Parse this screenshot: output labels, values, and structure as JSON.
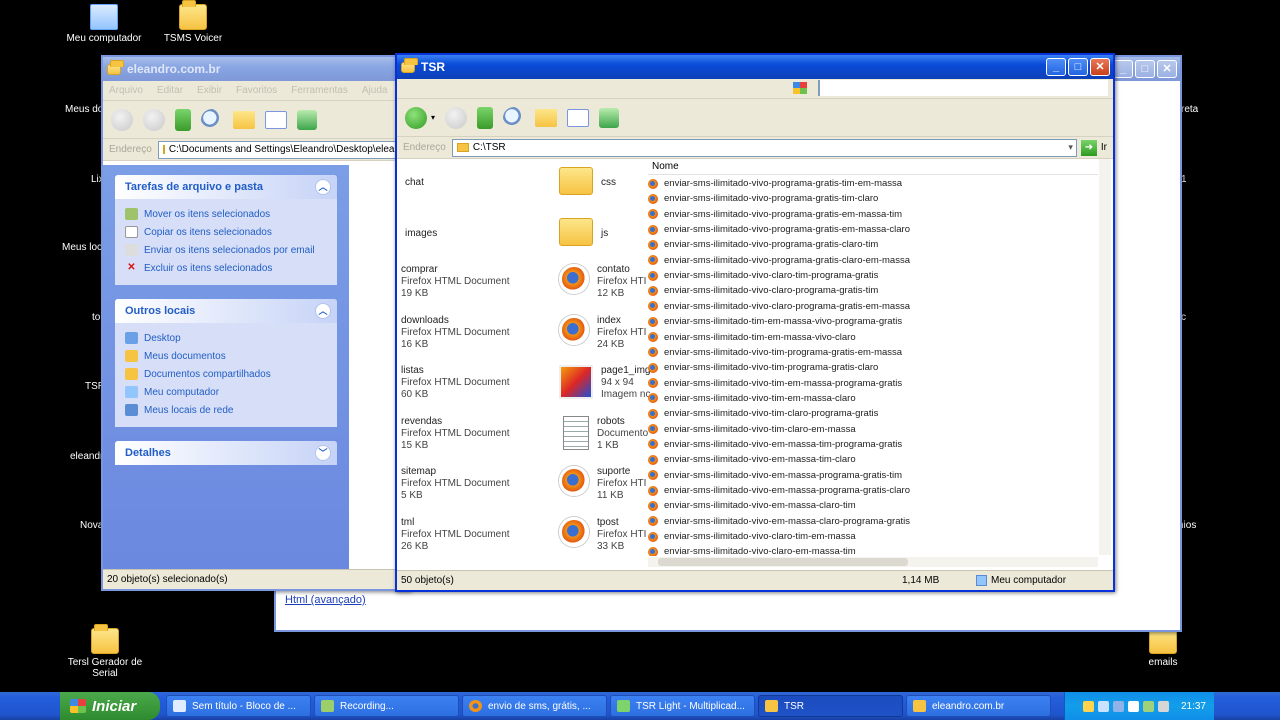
{
  "desktop": {
    "icons_left": [
      {
        "name": "Meu computador"
      },
      {
        "name": "Meus do"
      },
      {
        "name": "Lix"
      },
      {
        "name": "Meus loca"
      },
      {
        "name": "to"
      },
      {
        "name": "TSR"
      },
      {
        "name": "eleandr"
      },
      {
        "name": "Nova"
      },
      {
        "name": "Tersl Gerador de Serial"
      }
    ],
    "icon_tsms": "TSMS Voicer",
    "icon_emails": "emails",
    "right_edge_labels": [
      "reta",
      "1",
      "c",
      "nios"
    ]
  },
  "back_window": {
    "title": "",
    "link": "Html (avançado)"
  },
  "eleandro_window": {
    "title": "eleandro.com.br",
    "menu": [
      "Arquivo",
      "Editar",
      "Exibir",
      "Favoritos",
      "Ferramentas",
      "Ajuda"
    ],
    "address_label": "Endereço",
    "address": "C:\\Documents and Settings\\Eleandro\\Desktop\\eleandro.com.br",
    "panels": {
      "tasks_title": "Tarefas de arquivo e pasta",
      "tasks": [
        "Mover os itens selecionados",
        "Copiar os itens selecionados",
        "Enviar os itens selecionados por email",
        "Excluir os itens selecionados"
      ],
      "places_title": "Outros locais",
      "places": [
        "Desktop",
        "Meus documentos",
        "Documentos compartilhados",
        "Meu computador",
        "Meus locais de rede"
      ],
      "details_title": "Detalhes"
    },
    "items_col1": [
      {
        "name": "chat",
        "type": "",
        "size": ""
      },
      {
        "name": "images",
        "type": "",
        "size": ""
      },
      {
        "name": "comprar",
        "type": "Firefox HTML Document",
        "size": "19 KB"
      },
      {
        "name": "downloads",
        "type": "Firefox HTML Document",
        "size": "16 KB"
      },
      {
        "name": "listas",
        "type": "Firefox HTML Document",
        "size": "60 KB"
      },
      {
        "name": "revendas",
        "type": "Firefox HTML Document",
        "size": "15 KB"
      },
      {
        "name": "sitemap",
        "type": "Firefox HTML Document",
        "size": "5 KB"
      },
      {
        "name": "tml",
        "type": "Firefox HTML Document",
        "size": "26 KB"
      }
    ],
    "items_col2": [
      {
        "name": "css",
        "type": "",
        "size": ""
      },
      {
        "name": "js",
        "type": "",
        "size": ""
      },
      {
        "name": "contato",
        "type": "Firefox HTI",
        "size": "12 KB"
      },
      {
        "name": "index",
        "type": "Firefox HTI",
        "size": "24 KB"
      },
      {
        "name": "page1_img",
        "type": "94 x 94",
        "size": "Imagem nc"
      },
      {
        "name": "robots",
        "type": "Documento",
        "size": "1 KB"
      },
      {
        "name": "suporte",
        "type": "Firefox HTI",
        "size": "11 KB"
      },
      {
        "name": "tpost",
        "type": "Firefox HTI",
        "size": "33 KB"
      }
    ],
    "status": "20 objeto(s) selecionado(s)"
  },
  "tsr_window": {
    "title": "TSR",
    "address_label": "Endereço",
    "address": "C:\\TSR",
    "go_label": "Ir",
    "column_header": "Nome",
    "files": [
      "enviar-sms-ilimitado-vivo-programa-gratis-tim-em-massa",
      "enviar-sms-ilimitado-vivo-programa-gratis-tim-claro",
      "enviar-sms-ilimitado-vivo-programa-gratis-em-massa-tim",
      "enviar-sms-ilimitado-vivo-programa-gratis-em-massa-claro",
      "enviar-sms-ilimitado-vivo-programa-gratis-claro-tim",
      "enviar-sms-ilimitado-vivo-programa-gratis-claro-em-massa",
      "enviar-sms-ilimitado-vivo-claro-tim-programa-gratis",
      "enviar-sms-ilimitado-vivo-claro-programa-gratis-tim",
      "enviar-sms-ilimitado-vivo-claro-programa-gratis-em-massa",
      "enviar-sms-ilimitado-tim-em-massa-vivo-programa-gratis",
      "enviar-sms-ilimitado-tim-em-massa-vivo-claro",
      "enviar-sms-ilimitado-vivo-tim-programa-gratis-em-massa",
      "enviar-sms-ilimitado-vivo-tim-programa-gratis-claro",
      "enviar-sms-ilimitado-vivo-tim-em-massa-programa-gratis",
      "enviar-sms-ilimitado-vivo-tim-em-massa-claro",
      "enviar-sms-ilimitado-vivo-tim-claro-programa-gratis",
      "enviar-sms-ilimitado-vivo-tim-claro-em-massa",
      "enviar-sms-ilimitado-vivo-em-massa-tim-programa-gratis",
      "enviar-sms-ilimitado-vivo-em-massa-tim-claro",
      "enviar-sms-ilimitado-vivo-em-massa-programa-gratis-tim",
      "enviar-sms-ilimitado-vivo-em-massa-programa-gratis-claro",
      "enviar-sms-ilimitado-vivo-em-massa-claro-tim",
      "enviar-sms-ilimitado-vivo-em-massa-claro-programa-gratis",
      "enviar-sms-ilimitado-vivo-claro-tim-em-massa",
      "enviar-sms-ilimitado-vivo-claro-em-massa-tim"
    ],
    "status_objects": "50 objeto(s)",
    "status_size": "1,14 MB",
    "status_location": "Meu computador"
  },
  "taskbar": {
    "start_label": "Iniciar",
    "buttons": [
      {
        "label": "Sem título - Bloco de ..."
      },
      {
        "label": "Recording..."
      },
      {
        "label": "envio de sms, grátis, ..."
      },
      {
        "label": "TSR Light - Multiplicad..."
      },
      {
        "label": "TSR"
      },
      {
        "label": "eleandro.com.br"
      }
    ],
    "clock": "21:37"
  },
  "colors": {
    "xp_blue": "#0a4bd8",
    "task_pane": "#6b88e0",
    "start_green": "#3c9a3c"
  }
}
